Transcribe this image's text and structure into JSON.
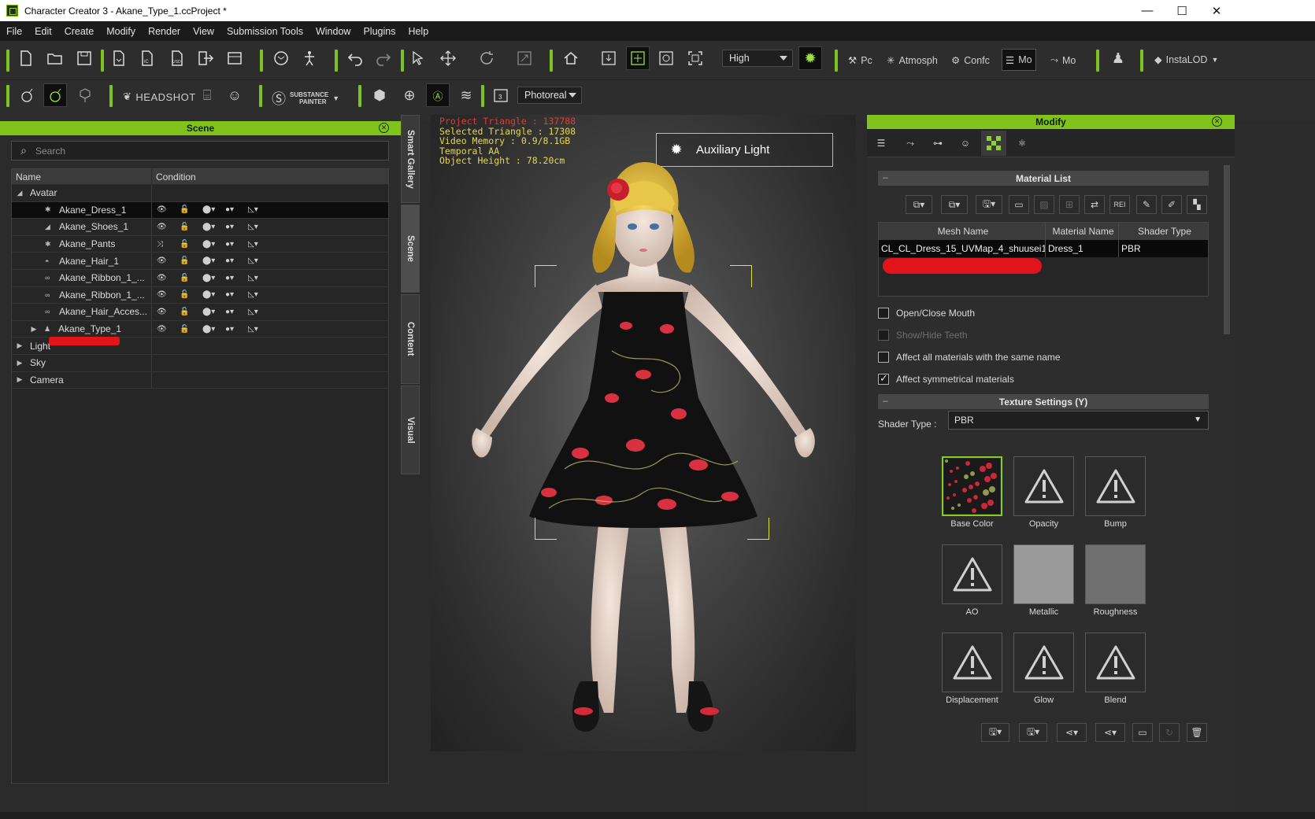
{
  "window": {
    "title": "Character Creator 3 - Akane_Type_1.ccProject *",
    "minimize": "—",
    "maximize": "☐",
    "close": "✕"
  },
  "menu": [
    "File",
    "Edit",
    "Create",
    "Modify",
    "Render",
    "View",
    "Submission Tools",
    "Window",
    "Plugins",
    "Help"
  ],
  "toolbar1": {
    "quality": "High",
    "pc_label": "Pc",
    "atmosphere_label": "Atmosph",
    "config_label": "Confc",
    "mo_label": "Mo",
    "mo2_label": "Mo",
    "instalod_label": "InstaLOD"
  },
  "toolbar2": {
    "headshot_label": "HEADSHOT",
    "substance_line1": "SUBSTANCE",
    "substance_line2": "PAINTER",
    "render_mode": "Photoreal"
  },
  "scene": {
    "title": "Scene",
    "search_placeholder": "Search",
    "col_name": "Name",
    "col_condition": "Condition",
    "rows": [
      {
        "name": "Avatar",
        "expander": "◢",
        "level": 0
      },
      {
        "name": "Akane_Dress_1",
        "icon": "✱",
        "level": 2,
        "selected": true
      },
      {
        "name": "Akane_Shoes_1",
        "icon": "◢",
        "level": 2
      },
      {
        "name": "Akane_Pants",
        "icon": "✱",
        "level": 2
      },
      {
        "name": "Akane_Hair_1",
        "icon": "◓",
        "level": 2
      },
      {
        "name": "Akane_Ribbon_1_...",
        "icon": "∞",
        "level": 2
      },
      {
        "name": "Akane_Ribbon_1_...",
        "icon": "∞",
        "level": 2
      },
      {
        "name": "Akane_Hair_Acces...",
        "icon": "∞",
        "level": 2
      },
      {
        "name": "Akane_Type_1",
        "icon": "♟",
        "expander": "▶",
        "level": 1
      },
      {
        "name": "Light",
        "expander": "▶",
        "level": 0
      },
      {
        "name": "Sky",
        "expander": "▶",
        "level": 0
      },
      {
        "name": "Camera",
        "expander": "▶",
        "level": 0
      }
    ]
  },
  "side_tabs": [
    "Smart Gallery",
    "Scene",
    "Content",
    "Visual"
  ],
  "viewport": {
    "project_triangle": "Project Triangle : 137788",
    "selected_triangle": "Selected Triangle : 17308",
    "video_memory": "Video Memory : 0.9/8.1GB",
    "temporal_aa": "Temporal AA",
    "object_height": "Object Height : 78.20cm",
    "aux_light": "Auxiliary Light"
  },
  "modify": {
    "title": "Modify",
    "material_list_title": "Material List",
    "col_mesh": "Mesh Name",
    "col_material": "Material Name",
    "col_shader": "Shader Type",
    "mesh_name": "CL_CL_Dress_15_UVMap_4_shuusei1",
    "material_name": "Dress_1",
    "shader_type": "PBR",
    "open_close_mouth": "Open/Close Mouth",
    "show_hide_teeth": "Show/Hide Teeth",
    "affect_all": "Affect all materials with the same name",
    "affect_symmetrical": "Affect symmetrical materials",
    "texture_settings_title": "Texture Settings  (Y)",
    "shader_type_label": "Shader Type :",
    "shader_type_value": "PBR",
    "textures": [
      "Base Color",
      "Opacity",
      "Bump",
      "AO",
      "Metallic",
      "Roughness",
      "Displacement",
      "Glow",
      "Blend"
    ]
  },
  "colors": {
    "accent": "#80c31c",
    "redaction": "#e0141a",
    "stats_yellow": "#e7d84a",
    "stats_red": "#e53a2d"
  }
}
